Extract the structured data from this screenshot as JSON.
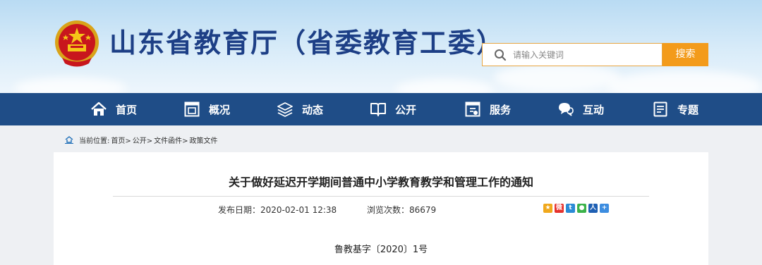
{
  "header": {
    "site_title": "山东省教育厅（省委教育工委）",
    "search_placeholder": "请输入关键词",
    "search_button": "搜索"
  },
  "nav": {
    "items": [
      {
        "label": "首页",
        "icon": "home-icon"
      },
      {
        "label": "概况",
        "icon": "window-icon"
      },
      {
        "label": "动态",
        "icon": "layers-icon"
      },
      {
        "label": "公开",
        "icon": "book-icon"
      },
      {
        "label": "服务",
        "icon": "service-icon"
      },
      {
        "label": "互动",
        "icon": "chat-icon"
      },
      {
        "label": "专题",
        "icon": "document-icon"
      }
    ]
  },
  "breadcrumb": {
    "prefix": "当前位置:",
    "items": [
      "首页>",
      "公开>",
      "文件函件>",
      "政策文件"
    ]
  },
  "article": {
    "title": "关于做好延迟开学期间普通中小学教育教学和管理工作的通知",
    "publish_label": "发布日期：",
    "publish_date": "2020-02-01 12:38",
    "views_label": "浏览次数：",
    "views": "86679",
    "doc_number": "鲁教基字〔2020〕1号",
    "share_icons": [
      "qzone-icon",
      "weibo-icon",
      "tencent-weibo-icon",
      "wechat-icon",
      "renren-icon",
      "more-share-icon"
    ]
  },
  "colors": {
    "nav_bg": "#1f4d87",
    "title_blue": "#1d3f86",
    "search_orange": "#f39b1b"
  }
}
